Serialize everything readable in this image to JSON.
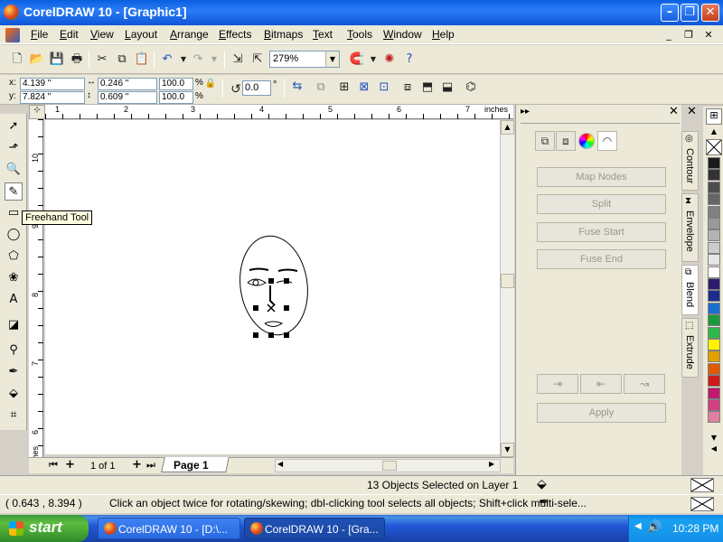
{
  "window": {
    "title": "CorelDRAW 10 - [Graphic1]"
  },
  "menu": [
    "File",
    "Edit",
    "View",
    "Layout",
    "Arrange",
    "Effects",
    "Bitmaps",
    "Text",
    "Tools",
    "Window",
    "Help"
  ],
  "toolbar": {
    "zoom": "279%"
  },
  "property_bar": {
    "x": "4.139 \"",
    "y": "7.824 \"",
    "width": "0.246 \"",
    "height": "0.609 \"",
    "scale_w": "100.0",
    "scale_h": "100.0",
    "pct": "%",
    "rotation": "0.0",
    "degree": "°"
  },
  "ruler": {
    "units": "inches",
    "h_ticks": [
      "1",
      "2",
      "3",
      "4",
      "5",
      "6",
      "7"
    ],
    "v_ticks": [
      "10",
      "9",
      "8",
      "7",
      "6"
    ],
    "v_units": "inches"
  },
  "tooltip": "Freehand Tool",
  "page_nav": {
    "count": "1 of 1",
    "tab": "Page 1"
  },
  "docker": {
    "buttons": [
      "Map Nodes",
      "Split",
      "Fuse Start",
      "Fuse End"
    ],
    "apply": "Apply",
    "tabs": [
      "Contour",
      "Envelope",
      "Blend",
      "Extrude"
    ]
  },
  "palette": [
    "#ffffff",
    "#000000",
    "#1a1a1a",
    "#333333",
    "#4d4d4d",
    "#666666",
    "#808080",
    "#999999",
    "#b3b3b3",
    "#cccccc",
    "#e6e6e6",
    "#ffffff",
    "#2e1a6e",
    "#1a2e8a",
    "#1a6ed0",
    "#1a9a3a",
    "#2eb84a",
    "#fff200",
    "#e0a000",
    "#e05a00",
    "#d01a1a",
    "#c01a6e",
    "#d04080",
    "#e080a0"
  ],
  "status": {
    "selection": "13 Objects Selected on Layer 1",
    "coords": "( 0.643 , 8.394  )",
    "hint": "Click an object twice for rotating/skewing; dbl-clicking tool selects all objects; Shift+click multi-sele..."
  },
  "taskbar": {
    "start": "start",
    "tasks": [
      "CorelDRAW 10 - [D:\\...",
      "CorelDRAW 10 - [Gra..."
    ],
    "clock": "10:28 PM"
  }
}
